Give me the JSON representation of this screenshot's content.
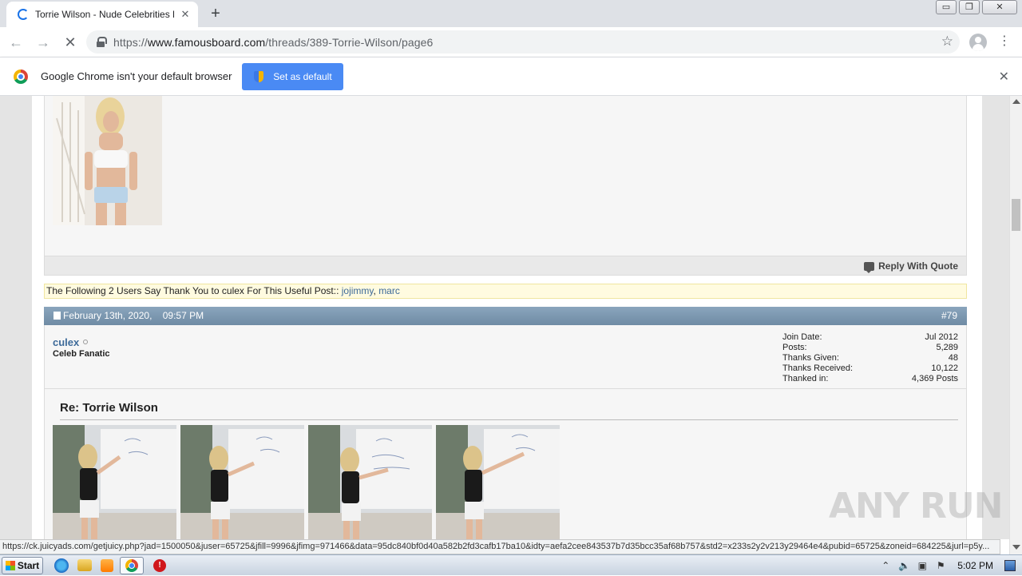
{
  "browser": {
    "tab_title": "Torrie Wilson - Nude Celebrities Foru",
    "tab_close": "✕",
    "new_tab": "+",
    "url_scheme": "https://",
    "url_host": "www.famousboard.com",
    "url_path": "/threads/389-Torrie-Wilson/page6",
    "window_buttons": {
      "minimize": "▭",
      "restore": "❐",
      "close": "✕"
    }
  },
  "infobar": {
    "message": "Google Chrome isn't your default browser",
    "button_label": "Set as default",
    "close": "✕"
  },
  "post1": {
    "reply_quote": "Reply With Quote"
  },
  "thanks": {
    "text": "The Following 2 Users Say Thank You to culex For This Useful Post:: ",
    "users": [
      "jojimmy",
      "marc"
    ],
    "separator": ", "
  },
  "post2": {
    "date": "February 13th, 2020,",
    "time": "09:57 PM",
    "number": "#79",
    "username": "culex",
    "user_title": "Celeb Fanatic",
    "stats": [
      {
        "label": "Join Date:",
        "value": "Jul 2012"
      },
      {
        "label": "Posts:",
        "value": "5,289"
      },
      {
        "label": "Thanks Given:",
        "value": "48"
      },
      {
        "label": "Thanks Received:",
        "value": "10,122"
      },
      {
        "label": "Thanked in:",
        "value": "4,369 Posts"
      }
    ],
    "title": "Re: Torrie Wilson"
  },
  "status_url": "https://ck.juicyads.com/getjuicy.php?jad=1500050&juser=65725&jfill=9996&jfimg=971466&data=95dc840bf0d40a582b2fd3cafb17ba10&idty=aefa2cee843537b7d35bcc35af68b757&std2=x233s2y2v213y29464e4&pubid=65725&zoneid=684225&jurl=p5y...",
  "watermark": "ANY RUN",
  "taskbar": {
    "start": "Start",
    "clock": "5:02 PM"
  }
}
